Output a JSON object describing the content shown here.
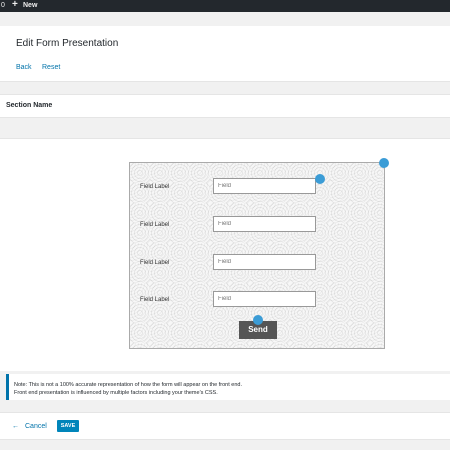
{
  "admin_bar": {
    "count": "0",
    "plus": "+",
    "new_label": "New"
  },
  "header": {
    "title": "Edit Form Presentation",
    "back_label": "Back",
    "reset_label": "Reset"
  },
  "section": {
    "name": "Section Name"
  },
  "form": {
    "fields": [
      {
        "label": "Field Label",
        "placeholder": "Field"
      },
      {
        "label": "Field Label",
        "placeholder": "Field"
      },
      {
        "label": "Field Label",
        "placeholder": "Field"
      },
      {
        "label": "Field Label",
        "placeholder": "Field"
      }
    ],
    "submit_label": "Send"
  },
  "note": {
    "line1": "Note: This is not a 100% accurate representation of how the form will appear on the front end.",
    "line2": "Front end presentation is influenced by multiple factors including your theme's CSS."
  },
  "footer": {
    "cancel_arrow": "←",
    "cancel_label": "Cancel",
    "save_label": "SAVE"
  },
  "colors": {
    "accent": "#0073aa",
    "handle": "#3b9cd6",
    "save_button": "#0085ba",
    "admin_bar": "#23282d"
  }
}
